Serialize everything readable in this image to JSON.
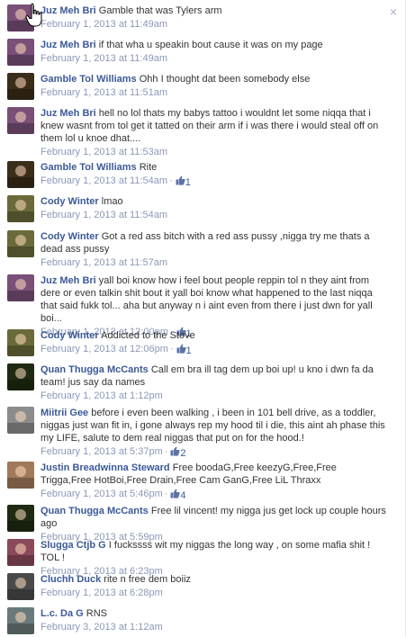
{
  "close_label": "×",
  "colors": {
    "author": "#3b5998",
    "meta": "#8a98b7",
    "text": "#333333"
  },
  "comments": [
    {
      "author": "Juz Meh Bri",
      "text": "Gamble that was Tylers arm",
      "time": "February 1, 2013 at 11:49am",
      "likes": "",
      "avatar_color": "#7a4f78"
    },
    {
      "author": "Juz Meh Bri",
      "text": "if that wha u speakin bout cause it was on my page",
      "time": "February 1, 2013 at 11:49am",
      "likes": "",
      "avatar_color": "#7a4f78"
    },
    {
      "author": "Gamble Tol Williams",
      "text": "Ohh I thought dat been somebody else",
      "time": "February 1, 2013 at 11:51am",
      "likes": "",
      "avatar_color": "#3a2d1a"
    },
    {
      "author": "Juz Meh Bri",
      "text": "hell no lol thats my babys tattoo i wouldnt let some niqqa that i knew wasnt from tol get it tatted on their arm if i was there i would steal off on them lol u knoe dhat....",
      "time": "February 1, 2013 at 11:53am",
      "likes": "",
      "avatar_color": "#7a4f78"
    },
    {
      "author": "Gamble Tol Williams",
      "text": "Rite",
      "time": "February 1, 2013 at 11:54am",
      "likes": "1",
      "avatar_color": "#3a2d1a"
    },
    {
      "author": "Cody Winter",
      "text": "lmao",
      "time": "February 1, 2013 at 11:54am",
      "likes": "",
      "avatar_color": "#6b6a3a"
    },
    {
      "author": "Cody Winter",
      "text": "Got a red ass bitch with a red ass pussy ,nigga try me thats a dead ass pussy",
      "time": "February 1, 2013 at 11:57am",
      "likes": "",
      "avatar_color": "#6b6a3a"
    },
    {
      "author": "Juz Meh Bri",
      "text": "yall boi know how i feel bout people reppin tol n they aint from dere or even talkin shit bout it yall boi know what happened to the last niqqa that said fukk tol... aha but anyway n i aint even from there i just dwn for yall boi...",
      "time": "February 1, 2013 at 12:00pm",
      "likes": "1",
      "avatar_color": "#7a4f78"
    },
    {
      "author": "Cody Winter",
      "text": "Addicted to the Stove",
      "time": "February 1, 2013 at 12:06pm",
      "likes": "1",
      "avatar_color": "#6b6a3a"
    },
    {
      "author": "Quan Thugga McCants",
      "text": "Call em bra ill tag dem up boi up! u kno i dwn fa da team! jus say da names",
      "time": "February 1, 2013 at 1:12pm",
      "likes": "",
      "avatar_color": "#1f2a12"
    },
    {
      "author": "Miitrii Gee",
      "text": "before i even been walking , i been in 101 bell drive, as a toddler, niggas just wan fit in, i gone always rep my hood til i die, this aint ah phase this my LIFE, salute to dem real niggas that put on for the hood.!",
      "time": "February 1, 2013 at 5:37pm",
      "likes": "2",
      "avatar_color": "#8c8c8c"
    },
    {
      "author": "Justin Breadwinna Steward",
      "text": "Free boodaG,Free keezyG,Free,Free Trigga,Free HotBoi,Free Drain,Free Cam GanG,Free LiL Thraxx",
      "time": "February 1, 2013 at 5:46pm",
      "likes": "4",
      "avatar_color": "#a07a5a"
    },
    {
      "author": "Quan Thugga McCants",
      "text": "Free lil vincent! my nigga jus get lock up couple hours ago",
      "time": "February 1, 2013 at 5:59pm",
      "likes": "",
      "avatar_color": "#1f2a12"
    },
    {
      "author": "Slugga Ctjb G",
      "text": "I fuckssss wit my niggas the long way , on some mafia shit ! TOL !",
      "time": "February 1, 2013 at 6:23pm",
      "likes": "",
      "avatar_color": "#8a4a5a"
    },
    {
      "author": "Cluchh Duck",
      "text": "rite n free dem boiiz",
      "time": "February 1, 2013 at 6:28pm",
      "likes": "",
      "avatar_color": "#4a4a4a"
    },
    {
      "author": "L.c. Da G",
      "text": "RNS",
      "time": "February 3, 2013 at 1:12am",
      "likes": "",
      "avatar_color": "#6a7a7a"
    }
  ]
}
